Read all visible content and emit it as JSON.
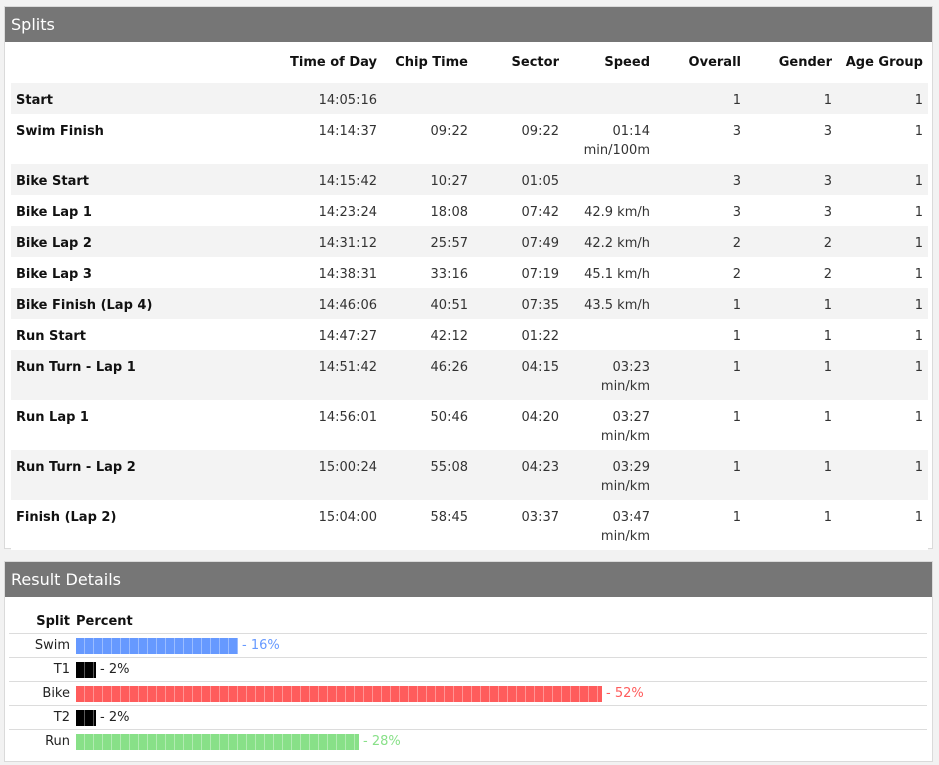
{
  "splits": {
    "title": "Splits",
    "columns": [
      "",
      "Time of Day",
      "Chip Time",
      "Sector",
      "Speed",
      "Overall",
      "Gender",
      "Age Group"
    ],
    "rows": [
      {
        "name": "Start",
        "tod": "14:05:16",
        "chip": "",
        "sector": "",
        "speed": "",
        "speed_unit": "",
        "overall": "1",
        "gender": "1",
        "age": "1"
      },
      {
        "name": "Swim Finish",
        "tod": "14:14:37",
        "chip": "09:22",
        "sector": "09:22",
        "speed": "01:14",
        "speed_unit": "min/100m",
        "overall": "3",
        "gender": "3",
        "age": "1"
      },
      {
        "name": "Bike Start",
        "tod": "14:15:42",
        "chip": "10:27",
        "sector": "01:05",
        "speed": "",
        "speed_unit": "",
        "overall": "3",
        "gender": "3",
        "age": "1"
      },
      {
        "name": "Bike Lap 1",
        "tod": "14:23:24",
        "chip": "18:08",
        "sector": "07:42",
        "speed": "42.9 km/h",
        "speed_unit": "",
        "overall": "3",
        "gender": "3",
        "age": "1"
      },
      {
        "name": "Bike Lap 2",
        "tod": "14:31:12",
        "chip": "25:57",
        "sector": "07:49",
        "speed": "42.2 km/h",
        "speed_unit": "",
        "overall": "2",
        "gender": "2",
        "age": "1"
      },
      {
        "name": "Bike Lap 3",
        "tod": "14:38:31",
        "chip": "33:16",
        "sector": "07:19",
        "speed": "45.1 km/h",
        "speed_unit": "",
        "overall": "2",
        "gender": "2",
        "age": "1"
      },
      {
        "name": "Bike Finish (Lap 4)",
        "tod": "14:46:06",
        "chip": "40:51",
        "sector": "07:35",
        "speed": "43.5 km/h",
        "speed_unit": "",
        "overall": "1",
        "gender": "1",
        "age": "1"
      },
      {
        "name": "Run Start",
        "tod": "14:47:27",
        "chip": "42:12",
        "sector": "01:22",
        "speed": "",
        "speed_unit": "",
        "overall": "1",
        "gender": "1",
        "age": "1"
      },
      {
        "name": "Run Turn - Lap 1",
        "tod": "14:51:42",
        "chip": "46:26",
        "sector": "04:15",
        "speed": "03:23",
        "speed_unit": "min/km",
        "overall": "1",
        "gender": "1",
        "age": "1"
      },
      {
        "name": "Run Lap 1",
        "tod": "14:56:01",
        "chip": "50:46",
        "sector": "04:20",
        "speed": "03:27",
        "speed_unit": "min/km",
        "overall": "1",
        "gender": "1",
        "age": "1"
      },
      {
        "name": "Run Turn - Lap 2",
        "tod": "15:00:24",
        "chip": "55:08",
        "sector": "04:23",
        "speed": "03:29",
        "speed_unit": "min/km",
        "overall": "1",
        "gender": "1",
        "age": "1"
      },
      {
        "name": "Finish (Lap 2)",
        "tod": "15:04:00",
        "chip": "58:45",
        "sector": "03:37",
        "speed": "03:47",
        "speed_unit": "min/km",
        "overall": "1",
        "gender": "1",
        "age": "1"
      }
    ]
  },
  "details": {
    "title": "Result Details",
    "header_split": "Split",
    "header_percent": "Percent",
    "items": [
      {
        "label": "Swim",
        "percent": 16,
        "text": "- 16%",
        "color": "#6699ff"
      },
      {
        "label": "T1",
        "percent": 2,
        "text": "- 2%",
        "color": "#000000"
      },
      {
        "label": "Bike",
        "percent": 52,
        "text": "- 52%",
        "color": "#ff5c5c"
      },
      {
        "label": "T2",
        "percent": 2,
        "text": "- 2%",
        "color": "#000000"
      },
      {
        "label": "Run",
        "percent": 28,
        "text": "- 28%",
        "color": "#88e088"
      }
    ]
  }
}
